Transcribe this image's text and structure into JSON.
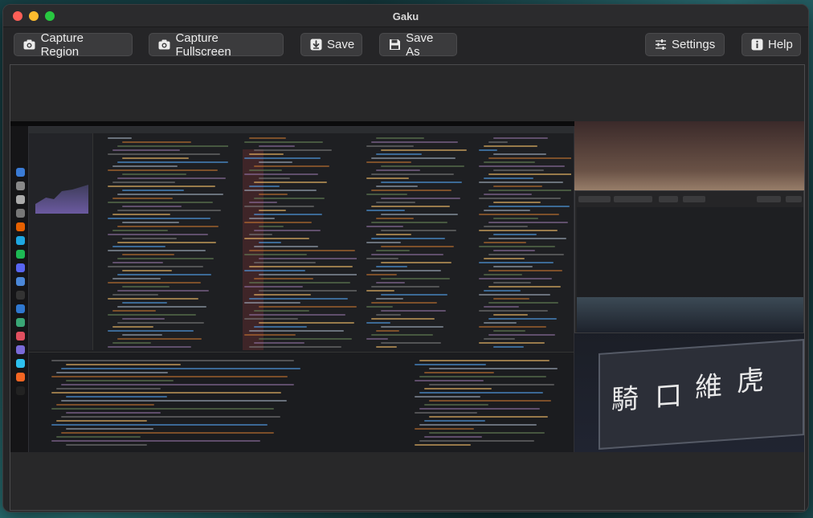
{
  "window": {
    "title": "Gaku"
  },
  "toolbar": {
    "capture_region_label": "Capture Region",
    "capture_fullscreen_label": "Capture Fullscreen",
    "save_label": "Save",
    "save_as_label": "Save As",
    "settings_label": "Settings",
    "help_label": "Help"
  },
  "icons": {
    "capture_region": "camera-icon",
    "capture_fullscreen": "camera-icon",
    "save": "download-icon",
    "save_as": "floppy-disk-icon",
    "settings": "sliders-icon",
    "help": "info-icon"
  },
  "colors": {
    "window_bg": "#252527",
    "button_bg": "#3b3b3d",
    "close": "#fe5f57",
    "minimize": "#febc2e",
    "maximize": "#28c840"
  }
}
